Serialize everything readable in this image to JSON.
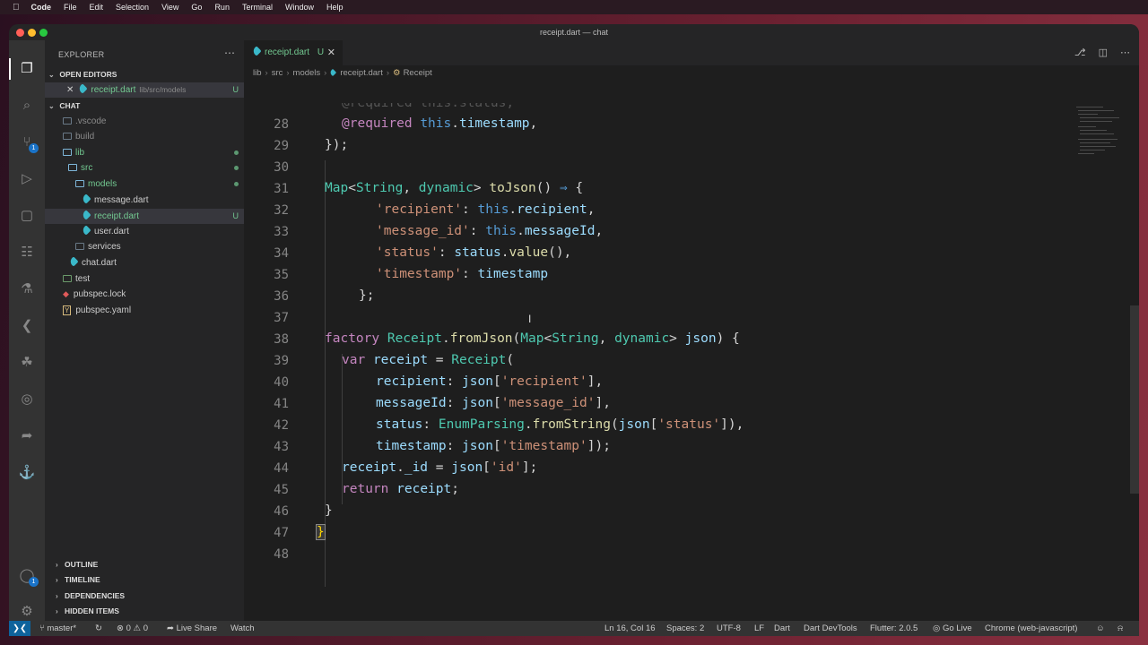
{
  "menubar": {
    "app": "Code",
    "items": [
      "File",
      "Edit",
      "Selection",
      "View",
      "Go",
      "Run",
      "Terminal",
      "Window",
      "Help"
    ]
  },
  "window": {
    "title": "receipt.dart — chat"
  },
  "sidebar": {
    "header": "EXPLORER",
    "open_editors_label": "OPEN EDITORS",
    "open_editor": {
      "name": "receipt.dart",
      "path": "lib/src/models",
      "status": "U"
    },
    "project_label": "CHAT",
    "tree": [
      {
        "name": ".vscode",
        "kind": "folder",
        "depth": 0
      },
      {
        "name": "build",
        "kind": "folder",
        "depth": 0
      },
      {
        "name": "lib",
        "kind": "folder",
        "depth": 0
      },
      {
        "name": "src",
        "kind": "folder",
        "depth": 1
      },
      {
        "name": "models",
        "kind": "folder",
        "depth": 2
      },
      {
        "name": "message.dart",
        "kind": "dart",
        "depth": 3
      },
      {
        "name": "receipt.dart",
        "kind": "dart",
        "depth": 3,
        "status": "U"
      },
      {
        "name": "user.dart",
        "kind": "dart",
        "depth": 3
      },
      {
        "name": "services",
        "kind": "folder",
        "depth": 2
      },
      {
        "name": "chat.dart",
        "kind": "dart",
        "depth": 1
      },
      {
        "name": "test",
        "kind": "folder",
        "depth": 0
      },
      {
        "name": "pubspec.lock",
        "kind": "lock",
        "depth": 0
      },
      {
        "name": "pubspec.yaml",
        "kind": "yaml",
        "depth": 0
      }
    ],
    "bottom_sections": [
      "OUTLINE",
      "TIMELINE",
      "DEPENDENCIES",
      "HIDDEN ITEMS"
    ]
  },
  "tab": {
    "name": "receipt.dart",
    "status": "U"
  },
  "breadcrumb": [
    "lib",
    "src",
    "models",
    "receipt.dart",
    "Receipt"
  ],
  "code": {
    "line_numbers": [
      "28",
      "29",
      "30",
      "31",
      "32",
      "33",
      "34",
      "35",
      "36",
      "37",
      "38",
      "39",
      "40",
      "41",
      "42",
      "43",
      "44",
      "45",
      "46",
      "47",
      "48"
    ]
  },
  "statusbar": {
    "branch": "master*",
    "problems": "0",
    "warnings": "0",
    "live_share": "Live Share",
    "watch": "Watch",
    "position": "Ln 16, Col 16",
    "spaces": "Spaces: 2",
    "encoding": "UTF-8",
    "eol": "LF",
    "language": "Dart",
    "devtools": "Dart DevTools",
    "flutter": "Flutter: 2.0.5",
    "go_live": "Go Live",
    "device": "Chrome (web-javascript)"
  }
}
